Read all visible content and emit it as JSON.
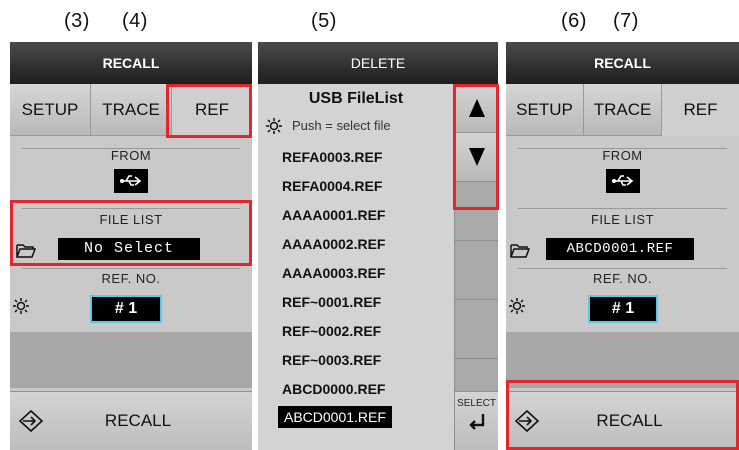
{
  "steps": [
    "(3)",
    "(4)",
    "(5)",
    "(6)",
    "(7)"
  ],
  "panel1": {
    "title": "RECALL",
    "tabs": [
      "SETUP",
      "TRACE",
      "REF"
    ],
    "from_label": "FROM",
    "file_list_label": "FILE LIST",
    "file_value": "No Select",
    "ref_no_label": "REF. NO.",
    "ref_no_value": "#   1",
    "recall_label": "RECALL"
  },
  "panel2": {
    "title": "DELETE",
    "list_title": "USB FileList",
    "hint": "Push = select file",
    "files": [
      "REFA0003.REF",
      "REFA0004.REF",
      "AAAA0001.REF",
      "AAAA0002.REF",
      "AAAA0003.REF",
      "REF~0001.REF",
      "REF~0002.REF",
      "REF~0003.REF",
      "ABCD0000.REF",
      "ABCD0001.REF"
    ],
    "selected_file": "ABCD0001.REF",
    "select_label": "SELECT"
  },
  "panel3": {
    "title": "RECALL",
    "tabs": [
      "SETUP",
      "TRACE",
      "REF"
    ],
    "from_label": "FROM",
    "file_list_label": "FILE LIST",
    "file_value": "ABCD0001.REF",
    "ref_no_label": "REF. NO.",
    "ref_no_value": "#   1",
    "recall_label": "RECALL"
  },
  "colors": {
    "highlight": "#e2262c",
    "refno_border": "#5ec9e6"
  }
}
